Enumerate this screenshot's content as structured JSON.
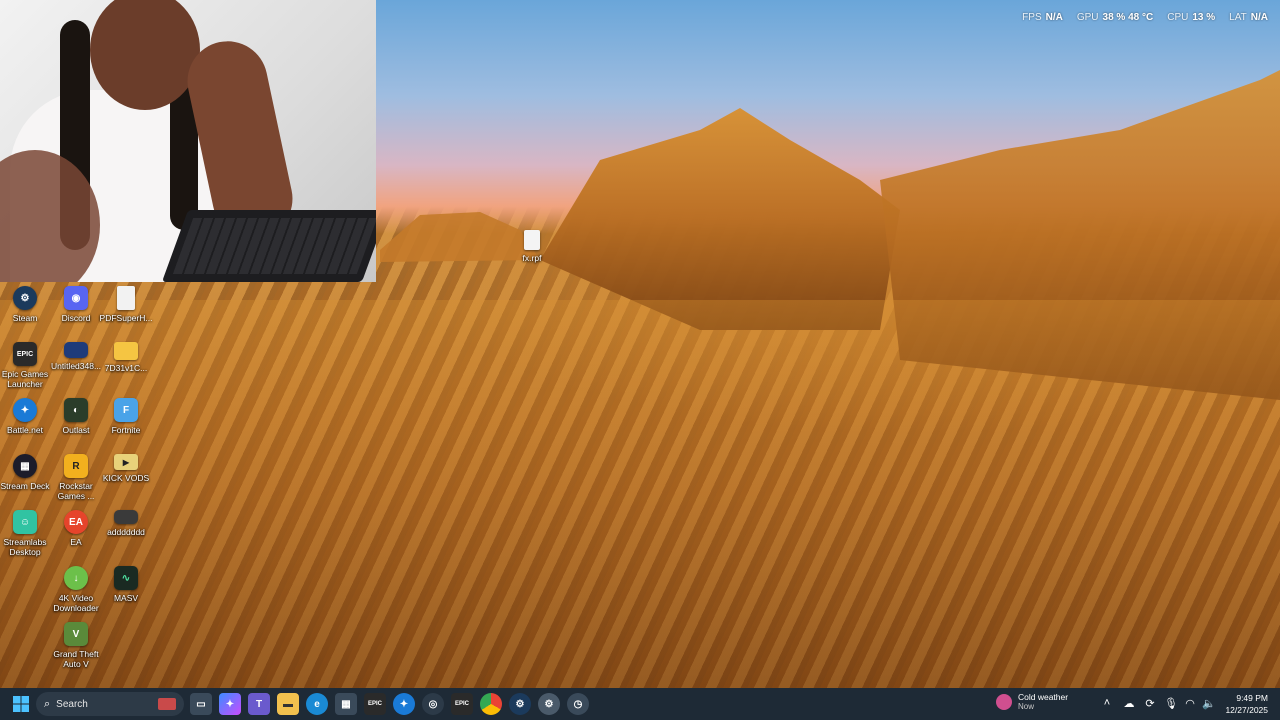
{
  "hud": [
    {
      "label": "FPS",
      "value": "N/A"
    },
    {
      "label": "GPU",
      "value": "38 %  48 °C"
    },
    {
      "label": "CPU",
      "value": "13 %"
    },
    {
      "label": "LAT",
      "value": "N/A"
    }
  ],
  "desktop_file": {
    "label": "fx.rpf"
  },
  "desktop_icons": {
    "steam": {
      "label": "Steam",
      "icon": "steam-icon",
      "color": "#1b3a5c"
    },
    "discord": {
      "label": "Discord",
      "icon": "discord-icon",
      "color": "#5865f2"
    },
    "pdfsuper": {
      "label": "PDFSuperH...",
      "icon": "document-icon",
      "color": "#f2f2f2"
    },
    "epic": {
      "label": "Epic Games Launcher",
      "icon": "epic-games-icon",
      "color": "#2a2a2a"
    },
    "untitled": {
      "label": "Untitled348...",
      "icon": "image-file-icon",
      "color": "#1e3b7a"
    },
    "folder": {
      "label": "7D31v1C...",
      "icon": "folder-icon",
      "color": "#f5c542"
    },
    "battlenet": {
      "label": "Battle.net",
      "icon": "battlenet-icon",
      "color": "#1a7ad6"
    },
    "outlast": {
      "label": "Outlast",
      "icon": "outlast-icon",
      "color": "#2b3d2a"
    },
    "fortnite": {
      "label": "Fortnite",
      "icon": "fortnite-icon",
      "color": "#4aa3e8"
    },
    "streamdeck": {
      "label": "Stream Deck",
      "icon": "stream-deck-icon",
      "color": "#1c1c2a"
    },
    "rockstar": {
      "label": "Rockstar Games ...",
      "icon": "rockstar-icon",
      "color": "#f2b01e"
    },
    "kickvods": {
      "label": "KICK VODS",
      "icon": "folder-video-icon",
      "color": "#e8d27a"
    },
    "streamlabs": {
      "label": "Streamlabs Desktop",
      "icon": "streamlabs-icon",
      "color": "#31c3a2"
    },
    "ea": {
      "label": "EA",
      "icon": "ea-icon",
      "color": "#e6442b"
    },
    "addddddd": {
      "label": "addddddd",
      "icon": "video-file-icon",
      "color": "#3a3a3a"
    },
    "fourk": {
      "label": "4K Video Downloader",
      "icon": "download-icon",
      "color": "#6cc04a"
    },
    "masv": {
      "label": "MASV",
      "icon": "masv-icon",
      "color": "#1a2a22"
    },
    "gta": {
      "label": "Grand Theft Auto V",
      "icon": "gta-icon",
      "color": "#5a8a3a"
    }
  },
  "taskbar": {
    "search_placeholder": "Search",
    "weather_title": "Cold weather",
    "weather_sub": "Now",
    "time": "9:49 PM",
    "date": "12/27/2025"
  }
}
